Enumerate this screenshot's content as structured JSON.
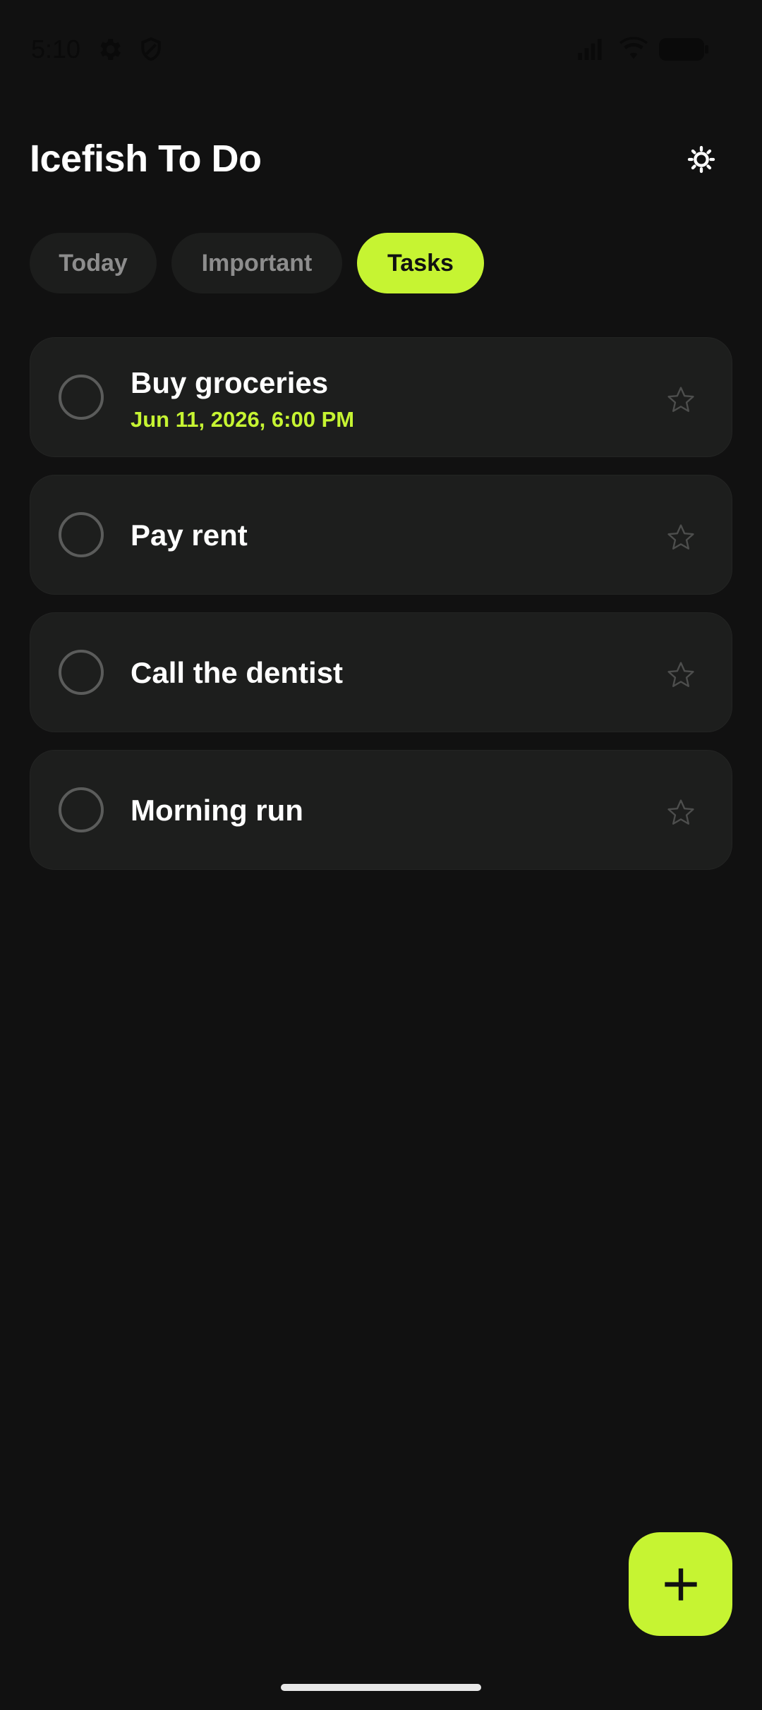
{
  "status_bar": {
    "time": "5:10",
    "icons": [
      "gear-icon",
      "shield-icon",
      "signal-icon",
      "wifi-icon",
      "battery-icon"
    ]
  },
  "header": {
    "title": "Icefish To Do",
    "settings_icon": "settings-sun-icon"
  },
  "tabs": [
    {
      "label": "Today",
      "active": false
    },
    {
      "label": "Important",
      "active": false
    },
    {
      "label": "Tasks",
      "active": true
    }
  ],
  "tasks": [
    {
      "title": "Buy groceries",
      "due": "Jun 11, 2026, 6:00 PM",
      "completed": false,
      "important": false
    },
    {
      "title": "Pay rent",
      "completed": false,
      "important": false
    },
    {
      "title": "Call the dentist",
      "completed": false,
      "important": false
    },
    {
      "title": "Morning run",
      "completed": false,
      "important": false
    }
  ],
  "fab": {
    "icon": "plus-icon"
  },
  "colors": {
    "background": "#111111",
    "accent": "#c6f432",
    "card": "#1d1e1d",
    "inactive_tab": "#1c1d1c",
    "inactive_tab_text": "#8d8d8d"
  }
}
